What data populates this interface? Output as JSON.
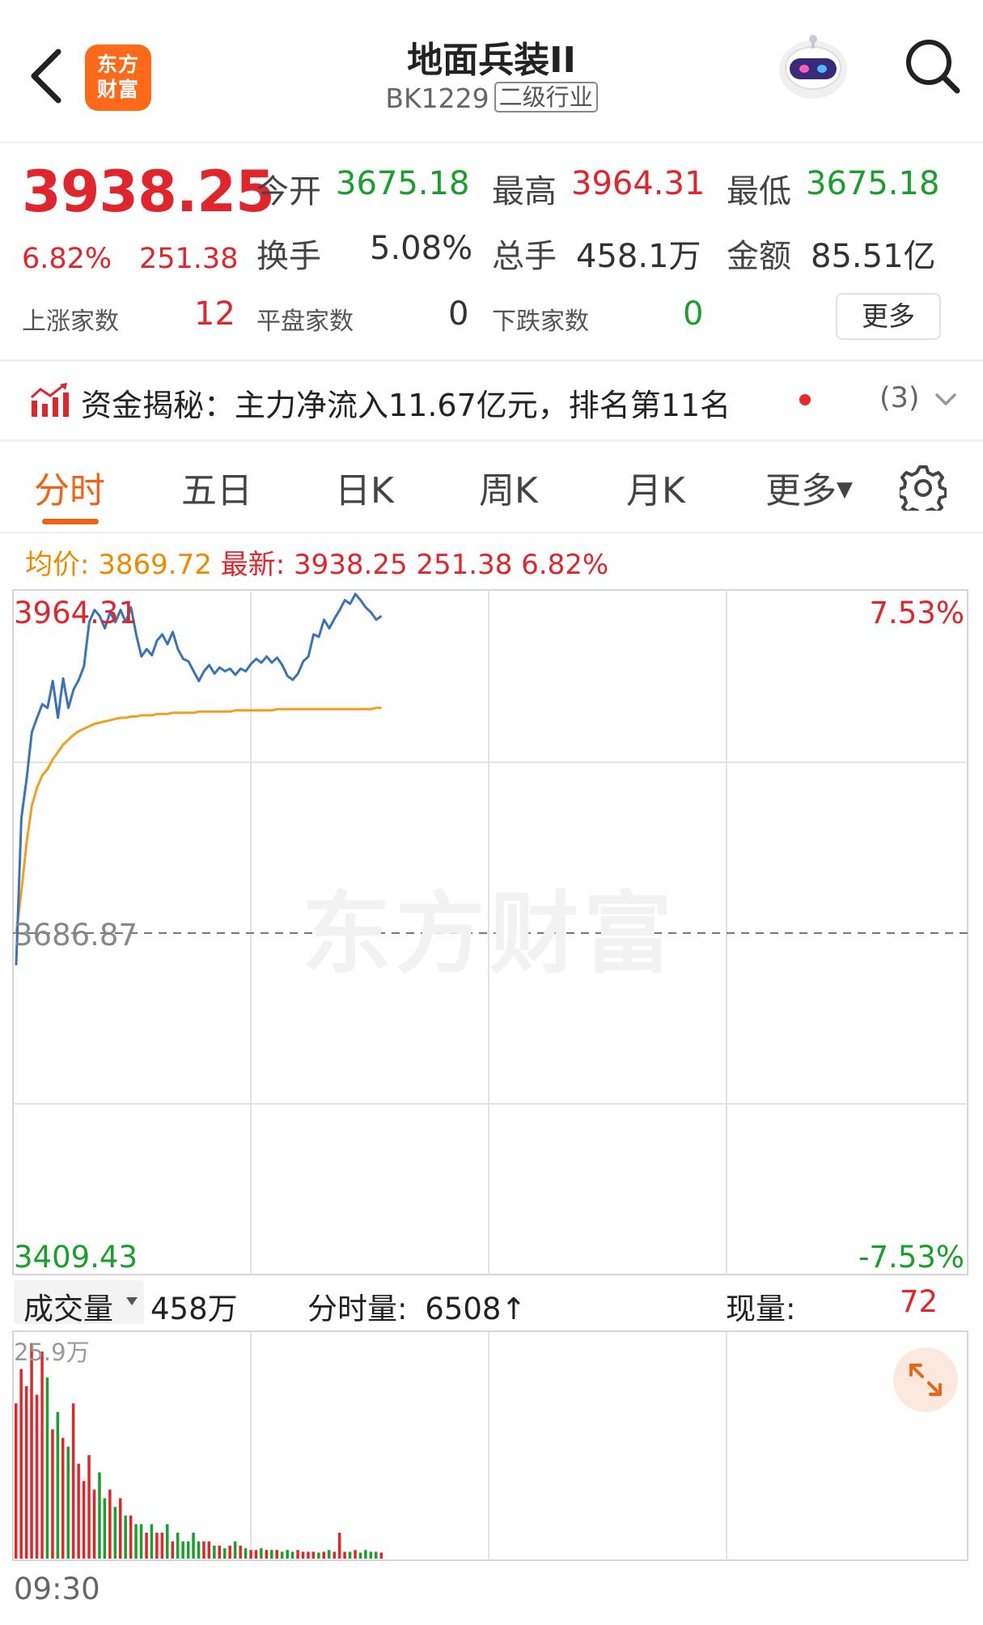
{
  "header": {
    "logo_text_1": "东方",
    "logo_text_2": "财富",
    "title": "地面兵装II",
    "code": "BK1229",
    "tag": "二级行业"
  },
  "quote": {
    "price": "3938.25",
    "pct": "6.82%",
    "change": "251.38",
    "open_label": "今开",
    "open": "3675.18",
    "high_label": "最高",
    "high": "3964.31",
    "low_label": "最低",
    "low": "3675.18",
    "turnover_label": "换手",
    "turnover": "5.08%",
    "volume_label": "总手",
    "volume": "458.1万",
    "amount_label": "金额",
    "amount": "85.51亿",
    "up_label": "上涨家数",
    "up": "12",
    "flat_label": "平盘家数",
    "flat": "0",
    "down_label": "下跌家数",
    "down": "0",
    "more_label": "更多"
  },
  "funds": {
    "text": "资金揭秘：主力净流入11.67亿元，排名第11名",
    "count": "(3)"
  },
  "tabs": [
    "分时",
    "五日",
    "日K",
    "周K",
    "月K",
    "更多"
  ],
  "chart_info": {
    "avg_label": "均价:",
    "avg": "3869.72",
    "latest_label": "最新:",
    "latest": "3938.25 251.38 6.82%"
  },
  "chart_labels": {
    "top_price": "3964.31",
    "mid_price": "3686.87",
    "bottom_price": "3409.43",
    "top_pct": "7.53%",
    "bottom_pct": "-7.53%",
    "watermark": "东方财富"
  },
  "volume": {
    "label": "成交量",
    "total": "458万",
    "minute_label": "分时量:",
    "minute_value": "6508↑",
    "current_label": "现量:",
    "current_value": "72",
    "max": "25.9万",
    "time_start": "09:30"
  },
  "colors": {
    "up": "#e0262c",
    "down": "#1a9e2c",
    "accent": "#ee6417",
    "price_line": "#3a73b8",
    "avg_line": "#f0a01e"
  },
  "chart_data": {
    "type": "line",
    "ylim": [
      3409.43,
      3964.31
    ],
    "base": 3686.87,
    "series": [
      {
        "name": "最新",
        "values": [
          3660,
          3780,
          3812,
          3850,
          3862,
          3873,
          3870,
          3892,
          3862,
          3894,
          3870,
          3885,
          3893,
          3904,
          3940,
          3950,
          3945,
          3935,
          3948,
          3940,
          3950,
          3940,
          3952,
          3930,
          3912,
          3918,
          3913,
          3925,
          3930,
          3922,
          3932,
          3918,
          3910,
          3908,
          3900,
          3892,
          3900,
          3905,
          3898,
          3903,
          3900,
          3902,
          3897,
          3902,
          3900,
          3906,
          3910,
          3907,
          3912,
          3907,
          3911,
          3905,
          3896,
          3893,
          3898,
          3908,
          3912,
          3930,
          3928,
          3942,
          3935,
          3943,
          3950,
          3958,
          3955,
          3963,
          3958,
          3952,
          3948,
          3942,
          3945
        ]
      },
      {
        "name": "均价",
        "values": [
          3686,
          3720,
          3760,
          3790,
          3805,
          3815,
          3820,
          3828,
          3834,
          3840,
          3844,
          3848,
          3851,
          3853,
          3855,
          3857,
          3858,
          3859,
          3860,
          3861,
          3862,
          3862,
          3863,
          3863,
          3864,
          3864,
          3864,
          3865,
          3865,
          3865,
          3866,
          3866,
          3866,
          3866,
          3866,
          3867,
          3867,
          3867,
          3867,
          3867,
          3867,
          3867,
          3868,
          3868,
          3868,
          3868,
          3868,
          3868,
          3868,
          3868,
          3869,
          3869,
          3869,
          3869,
          3869,
          3869,
          3869,
          3869,
          3869,
          3869,
          3869,
          3869,
          3869,
          3869,
          3869,
          3869,
          3869,
          3869,
          3869,
          3870,
          3870
        ]
      },
      {
        "name": "成交量",
        "values": [
          18,
          22,
          20,
          25,
          19,
          24,
          21,
          15,
          17,
          14,
          13,
          18,
          11,
          9,
          12,
          8,
          10,
          7,
          8,
          6,
          7,
          5,
          5,
          4,
          4,
          3,
          4,
          3,
          3,
          4,
          2,
          3,
          2,
          2,
          3,
          2,
          2,
          2,
          1.5,
          1.5,
          1.2,
          1.5,
          2,
          1.5,
          1.2,
          1,
          1,
          1.2,
          1,
          1,
          1,
          0.8,
          1,
          0.8,
          1,
          0.8,
          0.8,
          0.8,
          0.7,
          0.8,
          1,
          0.8,
          3,
          0.8,
          0.8,
          1,
          0.7,
          1,
          0.8,
          0.8,
          0.7
        ]
      }
    ]
  }
}
